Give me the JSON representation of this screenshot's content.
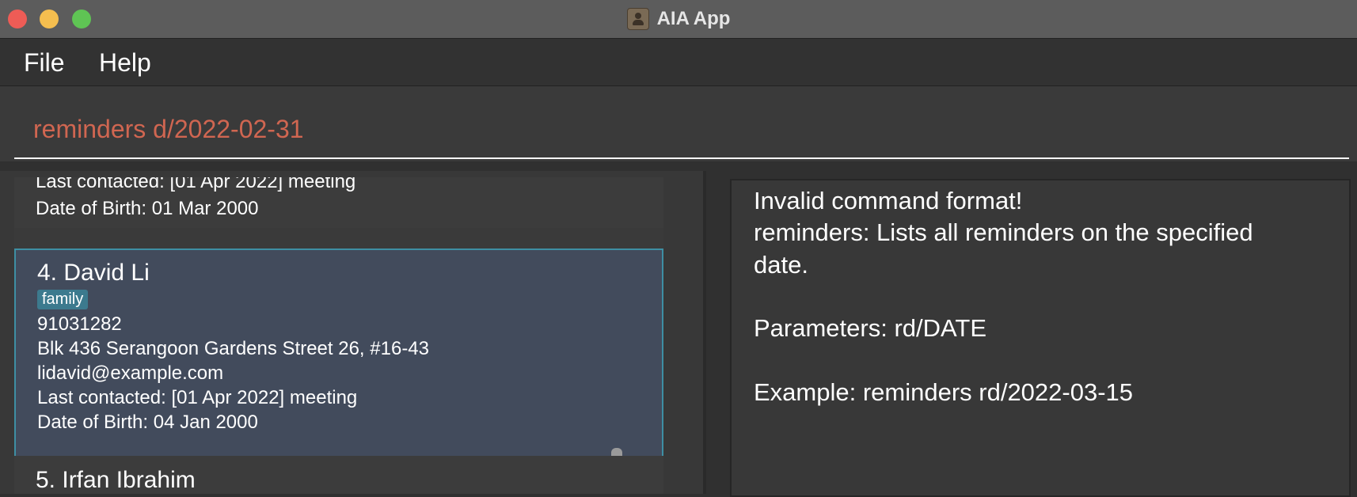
{
  "window": {
    "title": "AIA App",
    "app_icon": "contacts-app-icon"
  },
  "menu": {
    "file": "File",
    "help": "Help"
  },
  "command_box": {
    "value": "reminders d/2022-02-31",
    "text_color": "#d06651"
  },
  "person_list": {
    "previous_card": {
      "last_contacted": "Last contacted: [01 Apr 2022] meeting",
      "dob": "Date of Birth: 01 Mar 2000"
    },
    "selected_card": {
      "index_name": "4.  David Li",
      "tag": "family",
      "phone": "91031282",
      "address": "Blk 436 Serangoon Gardens Street 26, #16-43",
      "email": "lidavid@example.com",
      "last_contacted": "Last contacted: [01 Apr 2022] meeting",
      "dob": "Date of Birth: 04 Jan 2000"
    },
    "next_card": {
      "index_name": "5.  Irfan Ibrahim"
    }
  },
  "result_display": {
    "lines": [
      "Invalid command format!",
      "reminders: Lists all reminders on the specified",
      "date.",
      "Parameters: rd/DATE",
      "Example: reminders rd/2022-03-15"
    ]
  },
  "colors": {
    "selected_card_bg": "#424b5c",
    "selected_card_border": "#3e8fa3",
    "tag_bg": "#3c7a8e"
  }
}
